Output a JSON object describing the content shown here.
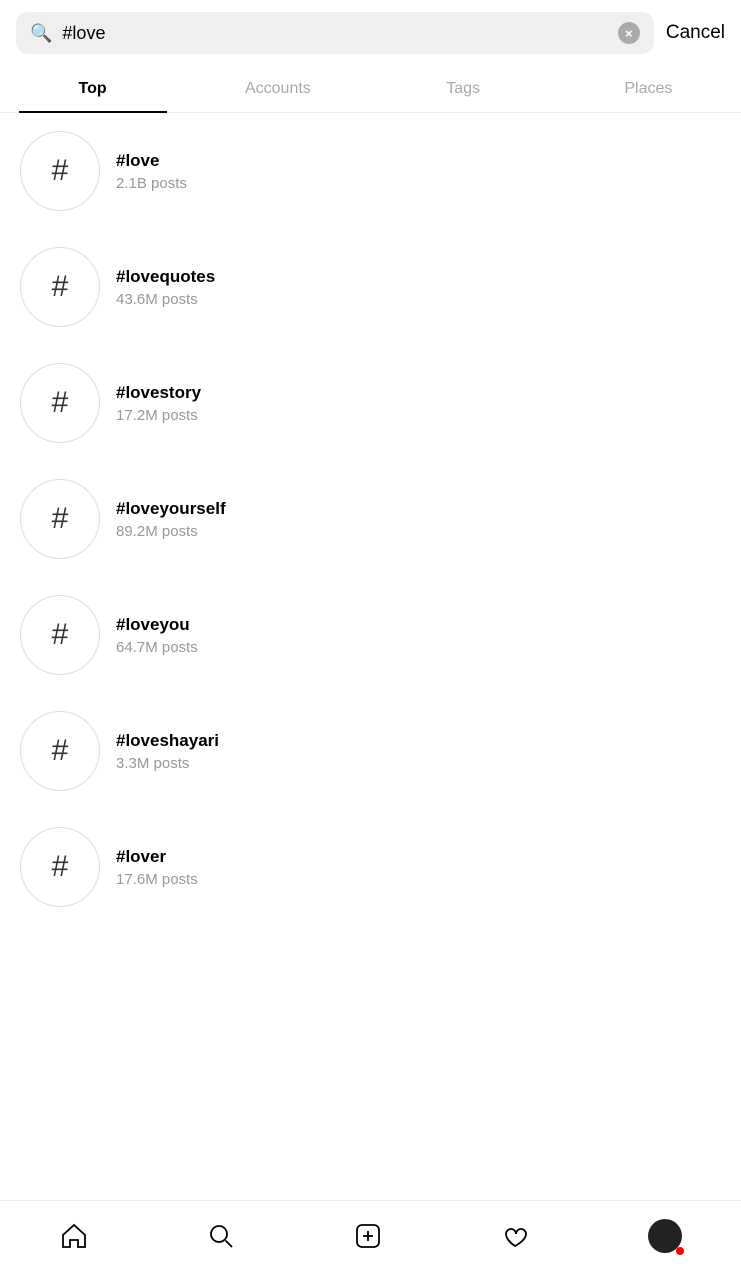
{
  "search": {
    "query": "#love",
    "clear_label": "×",
    "cancel_label": "Cancel",
    "placeholder": "Search"
  },
  "tabs": [
    {
      "id": "top",
      "label": "Top",
      "active": true
    },
    {
      "id": "accounts",
      "label": "Accounts",
      "active": false
    },
    {
      "id": "tags",
      "label": "Tags",
      "active": false
    },
    {
      "id": "places",
      "label": "Places",
      "active": false
    }
  ],
  "results": [
    {
      "tag": "#love",
      "count": "2.1B posts"
    },
    {
      "tag": "#lovequotes",
      "count": "43.6M posts"
    },
    {
      "tag": "#lovestory",
      "count": "17.2M posts"
    },
    {
      "tag": "#loveyourself",
      "count": "89.2M posts"
    },
    {
      "tag": "#loveyou",
      "count": "64.7M posts"
    },
    {
      "tag": "#loveshayari",
      "count": "3.3M posts"
    },
    {
      "tag": "#lover",
      "count": "17.6M posts"
    }
  ],
  "nav": {
    "home_label": "home",
    "search_label": "search",
    "post_label": "new post",
    "activity_label": "activity",
    "profile_label": "profile"
  }
}
